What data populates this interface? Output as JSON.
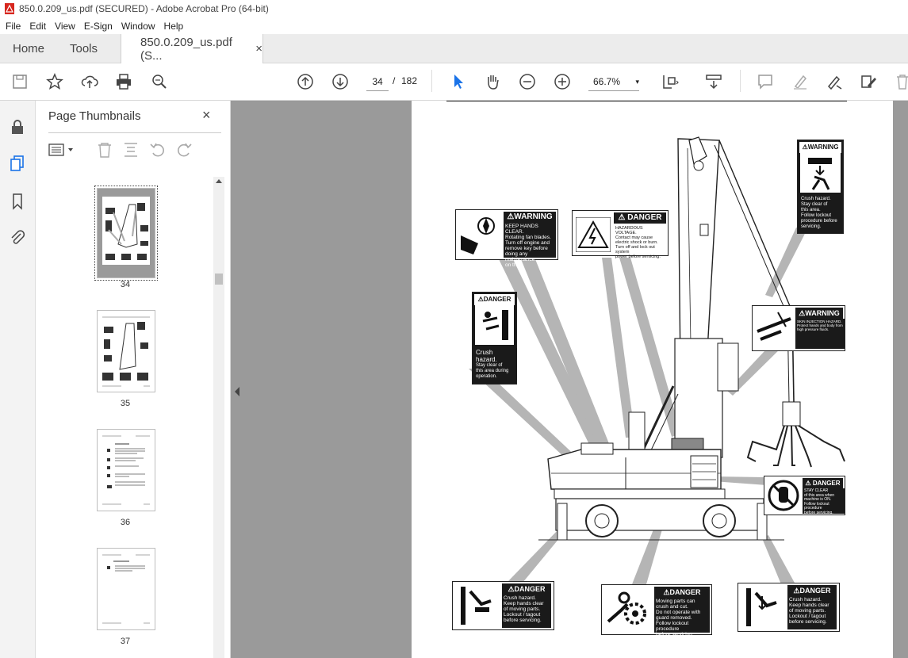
{
  "window": {
    "title": "850.0.209_us.pdf (SECURED) - Adobe Acrobat Pro (64-bit)"
  },
  "menu": [
    "File",
    "Edit",
    "View",
    "E-Sign",
    "Window",
    "Help"
  ],
  "tabs": {
    "home": "Home",
    "tools": "Tools",
    "doc": "850.0.209_us.pdf (S...",
    "doc_close": "×"
  },
  "toolbar": {
    "page_current": "34",
    "page_sep": "/",
    "page_total": "182",
    "zoom": "66.7%",
    "zoom_caret": "▾"
  },
  "panel": {
    "title": "Page Thumbnails",
    "close": "×",
    "thumbnails": [
      {
        "label": "34",
        "selected": true
      },
      {
        "label": "35",
        "selected": false
      },
      {
        "label": "36",
        "selected": false
      },
      {
        "label": "37",
        "selected": false
      }
    ]
  },
  "labels": {
    "fan": {
      "header": "⚠WARNING",
      "l1": "KEEP HANDS CLEAR.",
      "l2": "Rotating fan blades.",
      "l3": "Turn off engine and",
      "l4": "remove key before",
      "l5": "doing any maintenance",
      "l6": "on this"
    },
    "voltage": {
      "header": "⚠ DANGER",
      "l1": "HAZARDOUS",
      "l2": "VOLTAGE.",
      "l3": "Contact may cause",
      "l4": "electric shock or burn.",
      "l5": "Turn off and lock out system",
      "l6": "power before servicing."
    },
    "top_warning": {
      "header": "⚠WARNING",
      "l1": "Crush hazard.",
      "l2": "Stay clear of",
      "l3": "this area.",
      "l4": "Follow lockout",
      "l5": "procedure before",
      "l6": "servicing."
    },
    "crush_left": {
      "header": "⚠DANGER",
      "l1": "Crush",
      "l2": "hazard.",
      "l3": "Stay clear of",
      "l4": "this area during",
      "l5": "operation."
    },
    "injection": {
      "header": "⚠WARNING",
      "l1": "SKIN INJECTION HAZARD.",
      "l2": "Protect hands and body from",
      "l3": "high pressure fluids."
    },
    "stay_clear": {
      "header": "⚠ DANGER",
      "l1": "STAY CLEAR",
      "l2": "of this area when",
      "l3": "machine is ON.",
      "l4": "Follow lockout procedure",
      "l5": "before servicing."
    },
    "bottom_left": {
      "header": "⚠DANGER",
      "l1": "Crush hazard.",
      "l2": "Keep hands clear",
      "l3": "of moving parts.",
      "l4": "Lockout / tagout",
      "l5": "before servicing."
    },
    "bottom_mid": {
      "header": "⚠DANGER",
      "l1": "Moving parts can",
      "l2": "crush and cut.",
      "l3": "Do not operate with",
      "l4": "guard removed.",
      "l5": "Follow lockout procedure",
      "l6": "before servicing."
    },
    "bottom_right": {
      "header": "⚠DANGER",
      "l1": "Crush hazard.",
      "l2": "Keep hands clear",
      "l3": "of moving parts.",
      "l4": "Lockout / tagout",
      "l5": "before servicing."
    }
  }
}
